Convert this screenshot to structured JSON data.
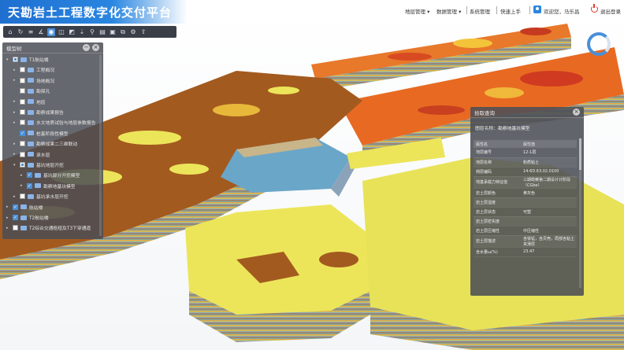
{
  "header": {
    "title": "天勘岩土工程数字化交付平台",
    "nav": [
      "地层管理 ▾",
      "数据管理 ▾",
      "系统管理",
      "快速上手"
    ],
    "user": "欢迎您，马乐昌",
    "logout": "退出登录"
  },
  "toolbar": {
    "icons": [
      "home-icon",
      "refresh-icon",
      "layers-icon",
      "measure-icon",
      "identify-icon",
      "cube-icon",
      "slice-icon",
      "drill-icon",
      "marker-icon",
      "section-icon",
      "screenshot-icon",
      "compare-icon",
      "settings-icon",
      "upload-icon"
    ]
  },
  "model_tree": {
    "title": "模型树",
    "items": [
      {
        "label": "T1航站楼",
        "level": 0,
        "state": "partial",
        "arrow": "▾"
      },
      {
        "label": "工程概况",
        "level": 1,
        "state": "unchecked",
        "arrow": "▸"
      },
      {
        "label": "场地概况",
        "level": 1,
        "state": "unchecked",
        "arrow": "▸"
      },
      {
        "label": "勘探孔",
        "level": 1,
        "state": "unchecked",
        "arrow": ""
      },
      {
        "label": "地层",
        "level": 1,
        "state": "unchecked",
        "arrow": "▸"
      },
      {
        "label": "勘察成果报告",
        "level": 1,
        "state": "unchecked",
        "arrow": "▸"
      },
      {
        "label": "水文地质试验与地层参数报告",
        "level": 1,
        "state": "unchecked",
        "arrow": "▸"
      },
      {
        "label": "桩基阶段性模型",
        "level": 1,
        "state": "checked",
        "arrow": ""
      },
      {
        "label": "勘察成果二三维联动",
        "level": 1,
        "state": "unchecked",
        "arrow": "▸"
      },
      {
        "label": "承水层",
        "level": 1,
        "state": "unchecked",
        "arrow": "▸"
      },
      {
        "label": "基坑地层开挖",
        "level": 1,
        "state": "partial",
        "arrow": "▾"
      },
      {
        "label": "基坑部分开挖模型",
        "level": 2,
        "state": "checked",
        "arrow": "▸"
      },
      {
        "label": "勘察地基坑模型",
        "level": 2,
        "state": "checked",
        "arrow": "▸"
      },
      {
        "label": "基坑承水层开挖",
        "level": 1,
        "state": "unchecked",
        "arrow": "▸"
      },
      {
        "label": "航站楼",
        "level": 0,
        "state": "checked",
        "arrow": "▸"
      },
      {
        "label": "T2航站楼",
        "level": 0,
        "state": "checked",
        "arrow": "▸"
      },
      {
        "label": "T2综合交通枢纽及T3下穿通道",
        "level": 0,
        "state": "unchecked",
        "arrow": "▸"
      }
    ]
  },
  "attr_panel": {
    "title": "拾取查询",
    "model_name": "图层名称：勘察地基坑模型",
    "headers": [
      "属性名",
      "属性值"
    ],
    "rows": [
      [
        "地层编号",
        "12-1层"
      ],
      [
        "地层名称",
        "粉质粘土"
      ],
      [
        "侧层编码",
        "14-6D.63.02.0100"
      ],
      [
        "地基承载力特征值",
        "三期勘察第二期设计计阶段（CGbe）"
      ],
      [
        "岩土层颜色",
        "黄灰色"
      ],
      [
        "岩土层湿度",
        ""
      ],
      [
        "岩土层状态",
        "可塑"
      ],
      [
        "岩土层密实度",
        ""
      ],
      [
        "岩土层压缩性",
        "中压缩性"
      ],
      [
        "岩土层描述",
        "含铁锰，含贝壳，局部含粘土夹薄层"
      ],
      [
        "含水量ω(%)",
        "23.47"
      ]
    ]
  },
  "scene": {
    "colors": {
      "yellow": "#ece55a",
      "brown": "#a0581e",
      "orange": "#e8722a",
      "red": "#d84a22",
      "teal": "#3f8c9a",
      "side": "#7a8fa8"
    }
  }
}
